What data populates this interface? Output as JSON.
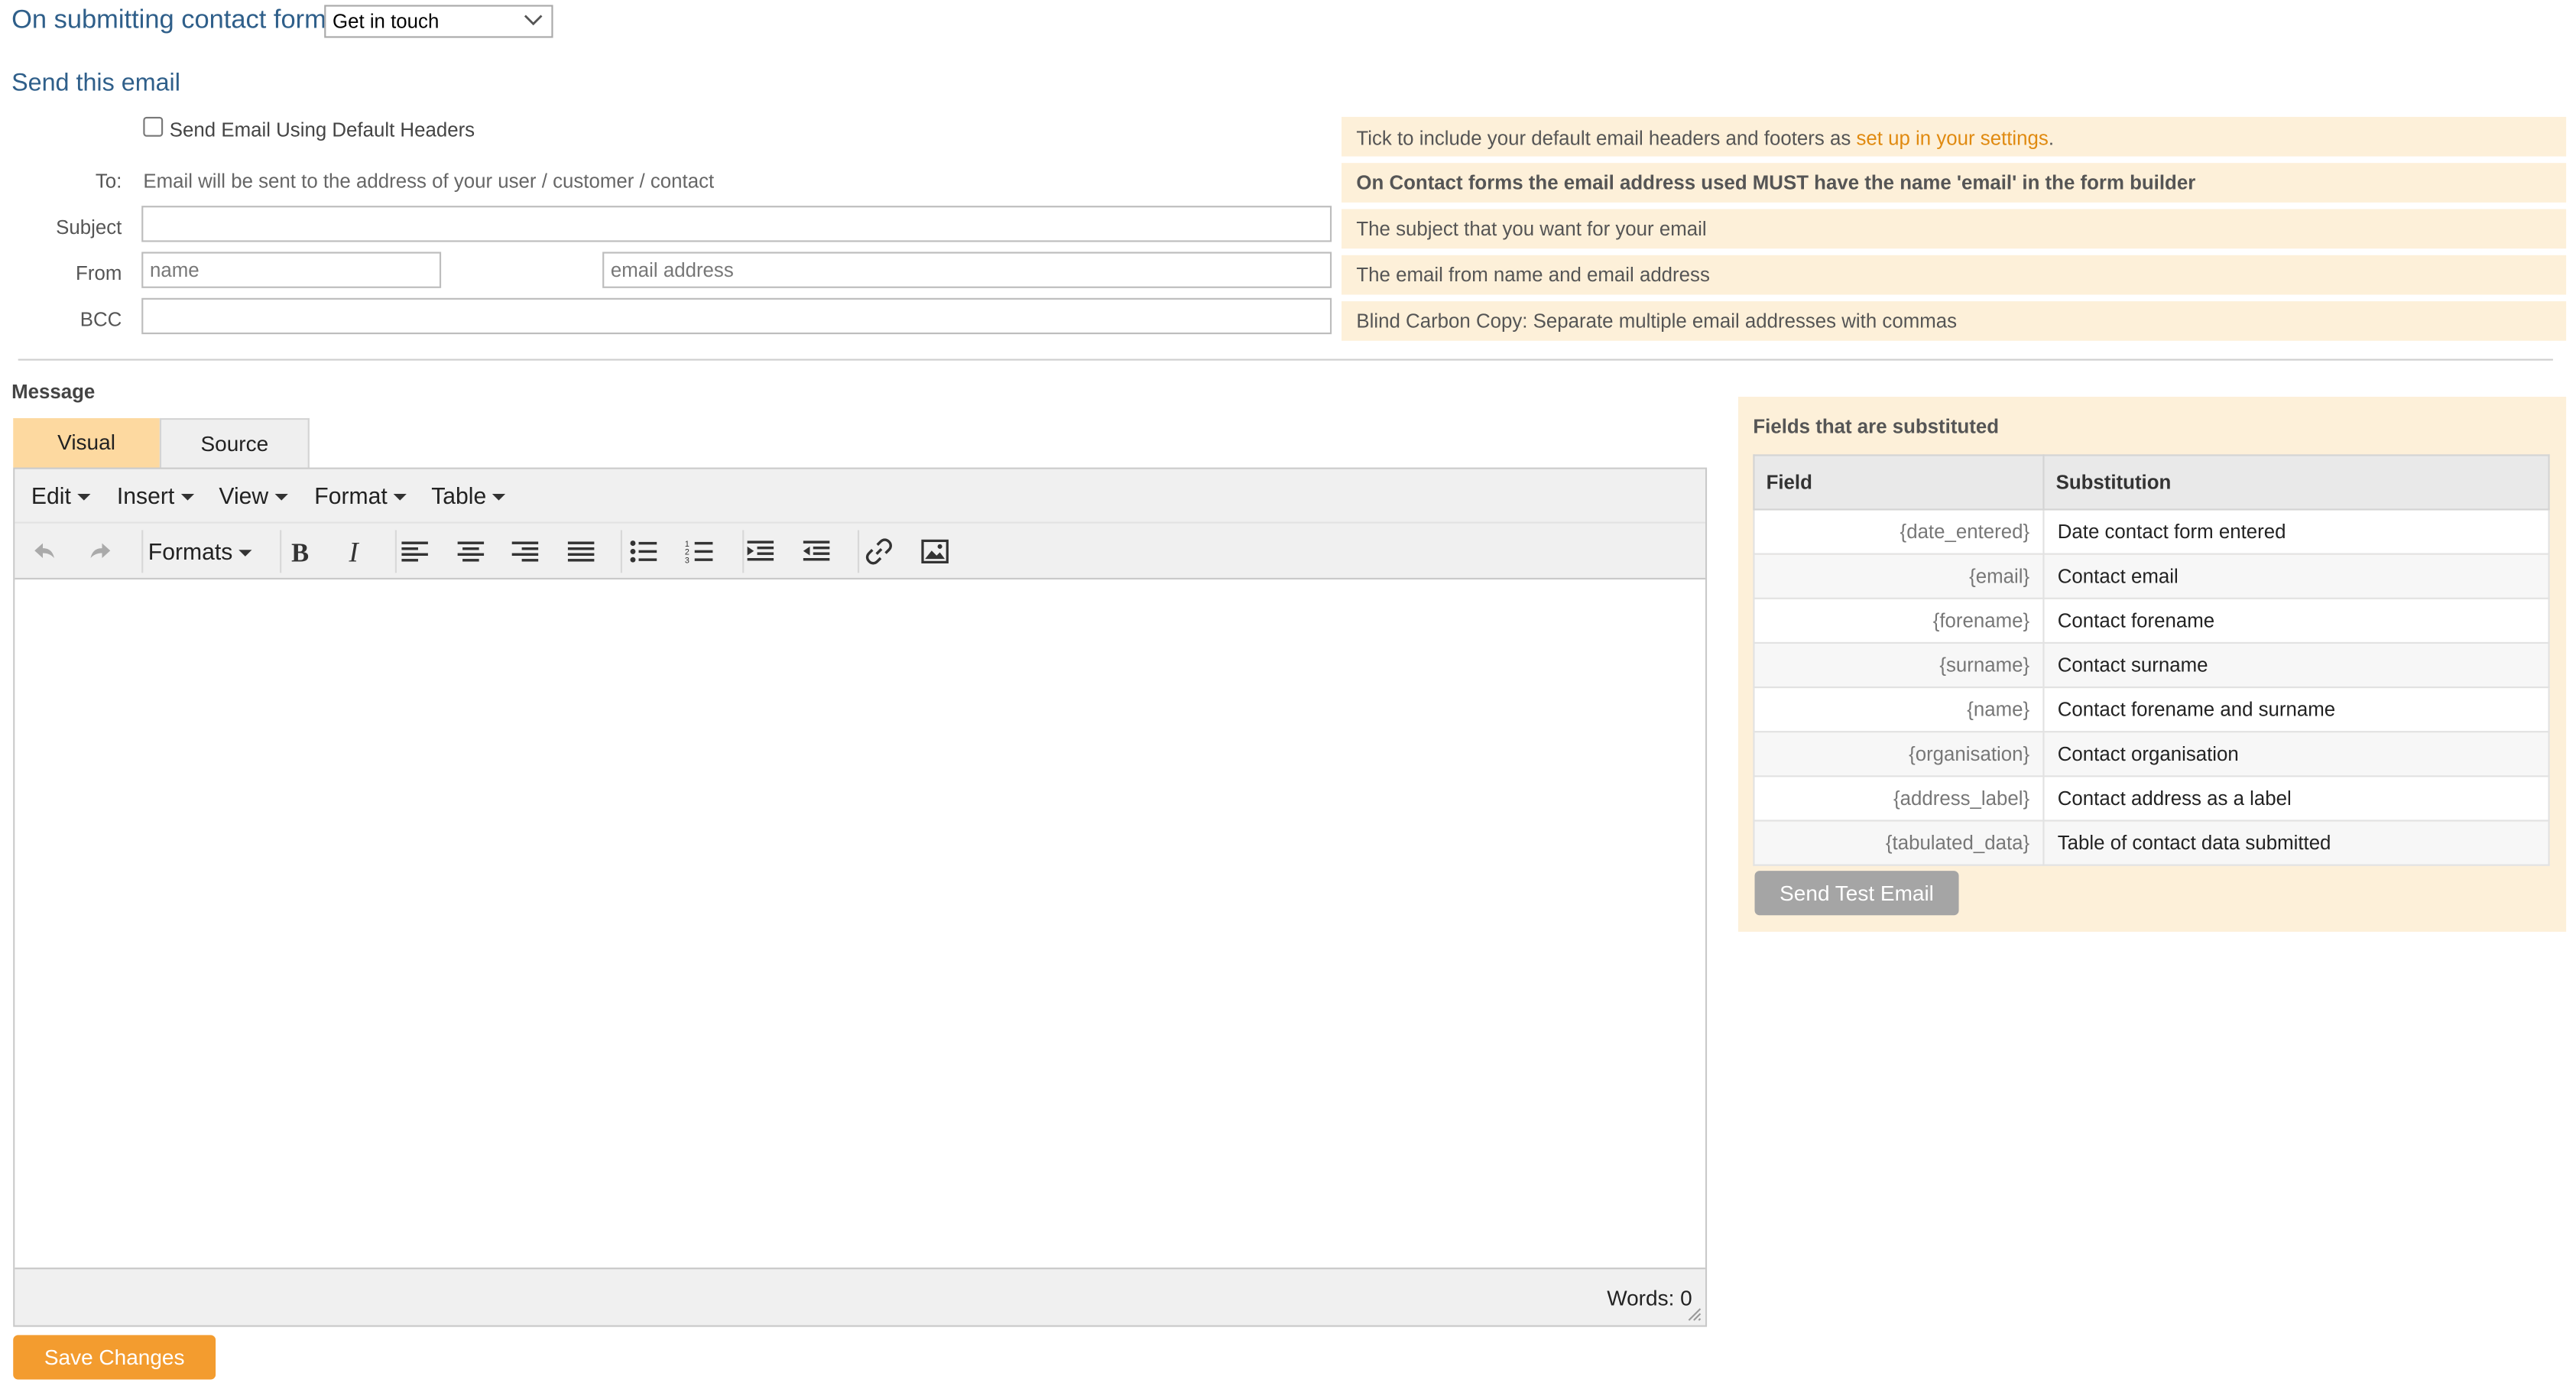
{
  "header": {
    "trigger_label": "On submitting contact form:",
    "trigger_select_value": "Get in touch",
    "section_title": "Send this email"
  },
  "form": {
    "default_headers_label": "Send Email Using Default Headers",
    "to_label": "To:",
    "to_text": "Email will be sent to the address of your user / customer / contact",
    "subject_label": "Subject",
    "subject_value": "",
    "from_label": "From",
    "from_name_placeholder": "name",
    "from_email_placeholder": "email address",
    "bcc_label": "BCC",
    "bcc_value": ""
  },
  "hints": {
    "headers_prefix": "Tick to include your default email headers and footers as ",
    "headers_link": "set up in your settings",
    "headers_suffix": ".",
    "to": "On Contact forms the email address used MUST have the name 'email' in the form builder",
    "subject": "The subject that you want for your email",
    "from": "The email from name and email address",
    "bcc": "Blind Carbon Copy: Separate multiple email addresses with commas"
  },
  "message": {
    "label": "Message",
    "tabs": [
      "Visual",
      "Source"
    ],
    "active_tab": "Visual",
    "menus": [
      "Edit",
      "Insert",
      "View",
      "Format",
      "Table"
    ],
    "formats_label": "Formats",
    "word_count": "Words: 0"
  },
  "actions": {
    "save_label": "Save Changes",
    "test_email_label": "Send Test Email"
  },
  "substitutions": {
    "title": "Fields that are substituted",
    "columns": [
      "Field",
      "Substitution"
    ],
    "rows": [
      {
        "field": "{date_entered}",
        "substitution": "Date contact form entered"
      },
      {
        "field": "{email}",
        "substitution": "Contact email"
      },
      {
        "field": "{forename}",
        "substitution": "Contact forename"
      },
      {
        "field": "{surname}",
        "substitution": "Contact surname"
      },
      {
        "field": "{name}",
        "substitution": "Contact forename and surname"
      },
      {
        "field": "{organisation}",
        "substitution": "Contact organisation"
      },
      {
        "field": "{address_label}",
        "substitution": "Contact address as a label"
      },
      {
        "field": "{tabulated_data}",
        "substitution": "Table of contact data submitted"
      }
    ]
  },
  "colors": {
    "accent": "#f39c2f",
    "link": "#e08a10",
    "hint_bg": "#fdf0d9",
    "heading": "#2f5f8a",
    "active_tab": "#fdd9a0"
  }
}
